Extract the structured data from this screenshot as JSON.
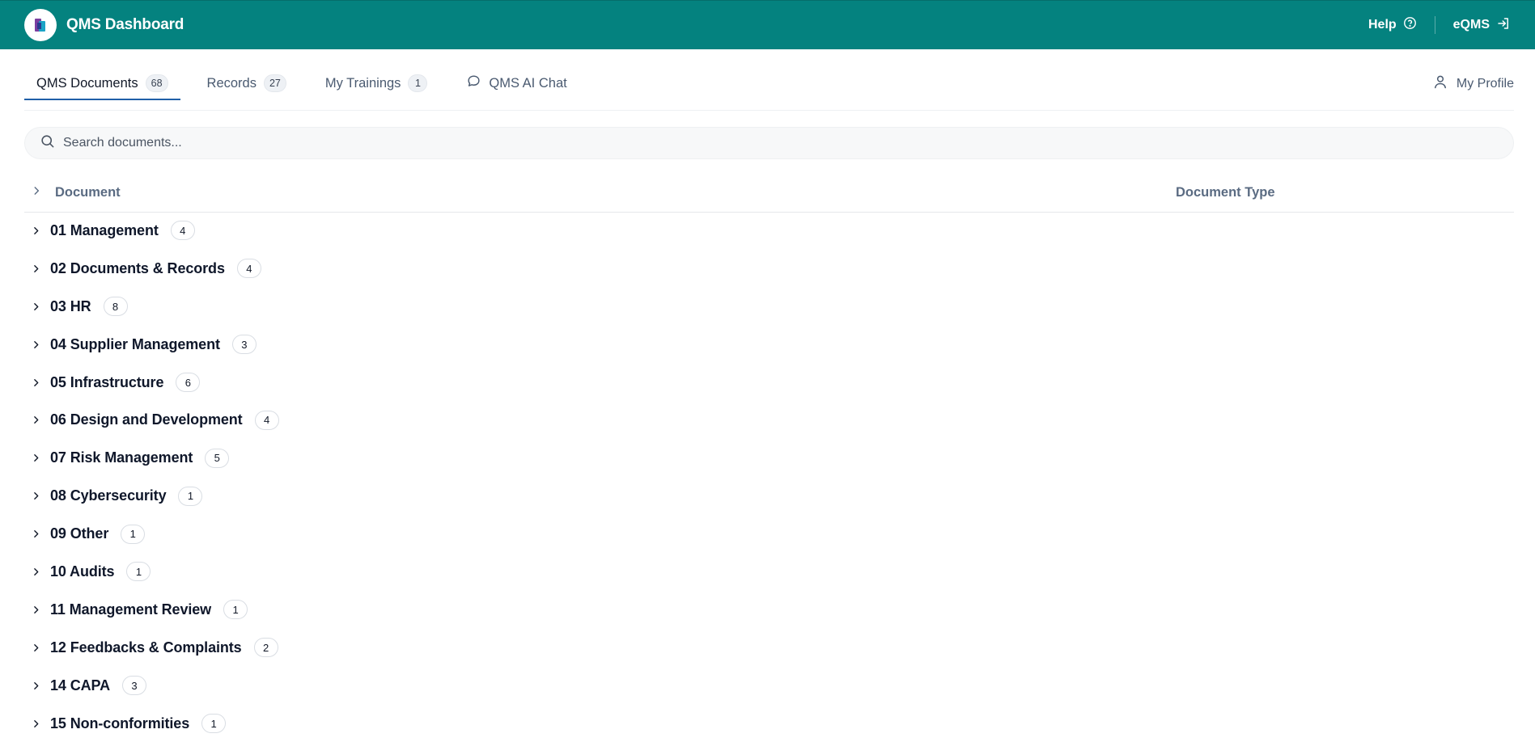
{
  "header": {
    "title": "QMS Dashboard",
    "help_label": "Help",
    "eqms_label": "eQMS",
    "brand_color": "#04827f"
  },
  "tabs": [
    {
      "label": "QMS Documents",
      "count": "68",
      "active": true
    },
    {
      "label": "Records",
      "count": "27",
      "active": false
    },
    {
      "label": "My Trainings",
      "count": "1",
      "active": false
    },
    {
      "label": "QMS AI Chat",
      "count": null,
      "active": false
    }
  ],
  "profile": {
    "label": "My Profile"
  },
  "search": {
    "placeholder": "Search documents..."
  },
  "table": {
    "col_document": "Document",
    "col_type": "Document Type",
    "rows": [
      {
        "name": "01 Management",
        "count": "4"
      },
      {
        "name": "02 Documents & Records",
        "count": "4"
      },
      {
        "name": "03 HR",
        "count": "8"
      },
      {
        "name": "04 Supplier Management",
        "count": "3"
      },
      {
        "name": "05 Infrastructure",
        "count": "6"
      },
      {
        "name": "06 Design and Development",
        "count": "4"
      },
      {
        "name": "07 Risk Management",
        "count": "5"
      },
      {
        "name": "08 Cybersecurity",
        "count": "1"
      },
      {
        "name": "09 Other",
        "count": "1"
      },
      {
        "name": "10 Audits",
        "count": "1"
      },
      {
        "name": "11 Management Review",
        "count": "1"
      },
      {
        "name": "12 Feedbacks & Complaints",
        "count": "2"
      },
      {
        "name": "14 CAPA",
        "count": "3"
      },
      {
        "name": "15 Non-conformities",
        "count": "1"
      }
    ]
  },
  "icons": {
    "help": "help-circle-icon",
    "eqms": "exit-icon",
    "chat": "chat-bubble-icon",
    "profile": "user-icon",
    "search": "search-icon",
    "chevron": "chevron-right-icon"
  }
}
